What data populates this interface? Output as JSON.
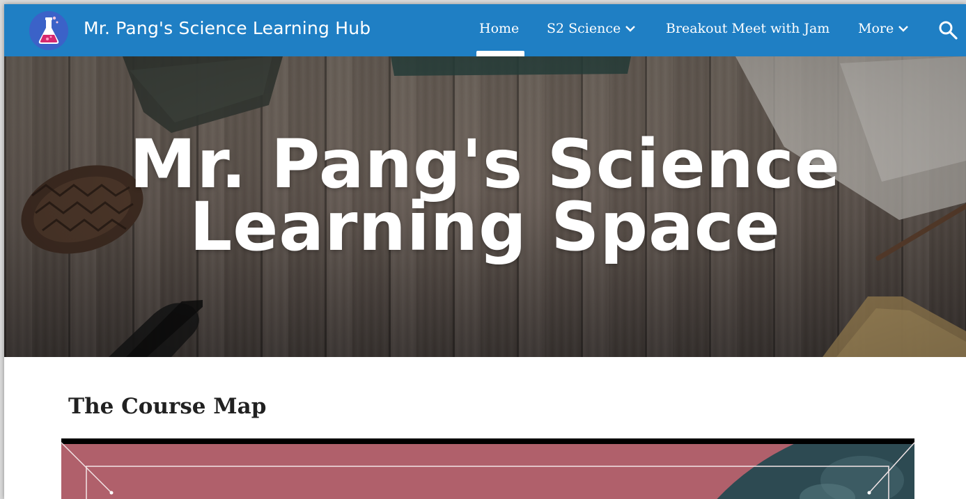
{
  "header": {
    "site_title": "Mr. Pang's Science Learning Hub",
    "logo_icon": "flask-icon",
    "nav": {
      "home": "Home",
      "s2_science": "S2 Science",
      "breakout": "Breakout Meet with Jam",
      "more": "More"
    },
    "active_nav": "Home",
    "search_icon": "search-icon"
  },
  "hero": {
    "title_line1": "Mr. Pang's Science",
    "title_line2": "Learning Space"
  },
  "main": {
    "section_heading": "The Course Map"
  },
  "colors": {
    "header_bg": "#1f7fc4",
    "course_map_pink": "#b0606b",
    "course_map_teal": "#2d4a52"
  }
}
